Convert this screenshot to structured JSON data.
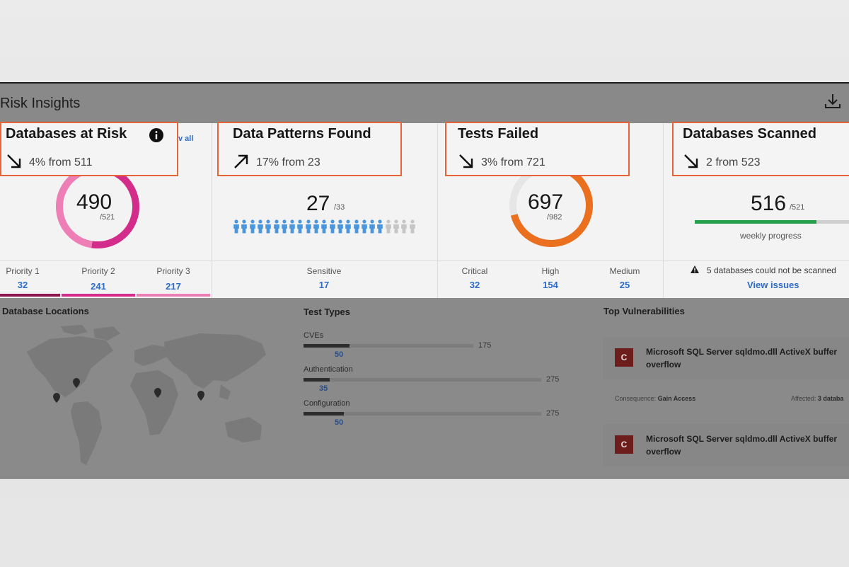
{
  "header": {
    "title": "Risk Insights",
    "download_icon": "download-icon"
  },
  "cards": {
    "databases_at_risk": {
      "title": "Databases at Risk",
      "trend": "4% from 511",
      "trend_direction": "down",
      "value": "490",
      "total": "/521",
      "view_all_partial": "v all",
      "priorities": [
        {
          "label": "Priority 1",
          "value": "32",
          "color": "#8e1650"
        },
        {
          "label": "Priority 2",
          "value": "241",
          "color": "#d32c8a"
        },
        {
          "label": "Priority 3",
          "value": "217",
          "color": "#ee7eb6"
        }
      ],
      "donut": {
        "priority_1": 32,
        "priority_2": 241,
        "priority_3": 217,
        "total": 521
      }
    },
    "data_patterns_found": {
      "title": "Data Patterns Found",
      "trend": "17% from 23",
      "trend_direction": "up",
      "value": "27",
      "total": "/33",
      "people_filled": 19,
      "people_total": 23,
      "sensitive_label": "Sensitive",
      "sensitive_value": "17"
    },
    "tests_failed": {
      "title": "Tests Failed",
      "trend": "3% from 721",
      "trend_direction": "down",
      "value": "697",
      "total": "/982",
      "severities": [
        {
          "label": "Critical",
          "value": "32"
        },
        {
          "label": "High",
          "value": "154"
        },
        {
          "label": "Medium",
          "value": "25"
        }
      ],
      "donut": {
        "failed": 697,
        "total": 982
      }
    },
    "databases_scanned": {
      "title": "Databases Scanned",
      "trend": "2 from 523",
      "trend_direction": "down",
      "value": "516",
      "total": "/521",
      "progress_label": "weekly progress",
      "progress": 0.79,
      "warning": "5 databases could not be scanned",
      "view_issues": "View issues"
    }
  },
  "bottom": {
    "locations_title": "Database Locations",
    "test_types_title": "Test Types",
    "test_types": [
      {
        "label": "CVEs",
        "count": "50",
        "total": "175",
        "fraction": 0.27
      },
      {
        "label": "Authentication",
        "count": "35",
        "total": "275",
        "fraction": 0.11
      },
      {
        "label": "Configuration",
        "count": "50",
        "total": "275",
        "fraction": 0.17
      }
    ],
    "vulns_title": "Top Vulnerabilities",
    "vulns": [
      {
        "badge": "C",
        "title": "Microsoft SQL Server sqldmo.dll ActiveX buffer overflow"
      },
      {
        "badge": "C",
        "title": "Microsoft SQL Server sqldmo.dll ActiveX buffer overflow"
      }
    ],
    "consequence_label": "Consequence:",
    "consequence_value": "Gain Access",
    "affected_label": "Affected:",
    "affected_value": "3 databa"
  },
  "colors": {
    "highlight": "#e5643a",
    "link": "#2d6bc9",
    "orange": "#ea6f1e",
    "green": "#24a148",
    "magenta": "#d32c8a"
  }
}
